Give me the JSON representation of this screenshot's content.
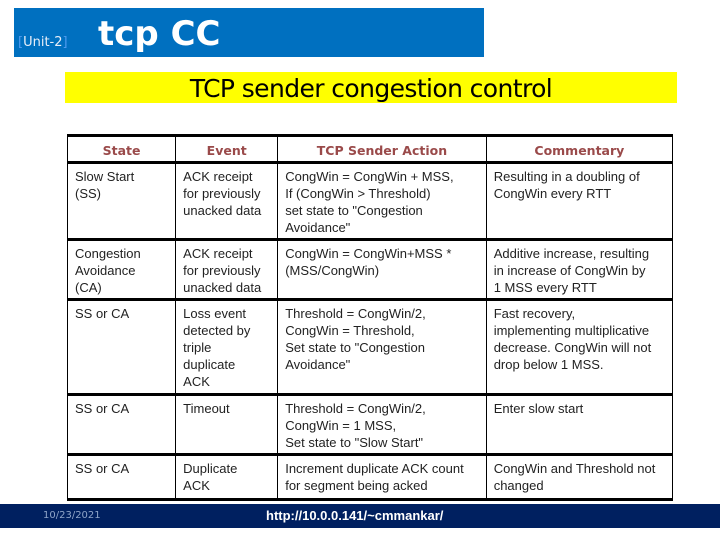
{
  "header": {
    "unit_label": "Unit-2",
    "unit_bracket_open": "[",
    "unit_bracket_close": "]",
    "title": "tcp CC",
    "subtitle": "TCP sender congestion control"
  },
  "colors": {
    "title_bar": "#0070c0",
    "subtitle_bar": "#ffff00",
    "table_header_text": "#9a4a4a",
    "footer_bar": "#002060"
  },
  "table": {
    "columns": [
      "State",
      "Event",
      "TCP Sender Action",
      "Commentary"
    ],
    "rows": [
      {
        "state": "Slow Start\n(SS)",
        "event": "ACK receipt\nfor previously\nunacked data",
        "action": "CongWin = CongWin + MSS,\nIf (CongWin > Threshold)\n      set state to \"Congestion\nAvoidance\"",
        "commentary": "Resulting in a doubling of\nCongWin every RTT"
      },
      {
        "state": "Congestion\nAvoidance\n(CA)",
        "event": "ACK receipt\nfor previously\nunacked data",
        "action": "CongWin = CongWin+MSS *\n(MSS/CongWin)",
        "commentary": "Additive increase, resulting\nin increase of CongWin  by\n1 MSS every RTT"
      },
      {
        "state": "SS or CA",
        "event": "Loss event\ndetected by\ntriple\nduplicate\nACK",
        "action": "Threshold = CongWin/2,\nCongWin = Threshold,\nSet state to \"Congestion\nAvoidance\"",
        "commentary": "Fast recovery,\nimplementing multiplicative\ndecrease. CongWin will not\ndrop below 1 MSS."
      },
      {
        "state": "SS or CA",
        "event": "Timeout",
        "action": "Threshold = CongWin/2,\nCongWin = 1 MSS,\nSet state to \"Slow Start\"",
        "commentary": "Enter slow start"
      },
      {
        "state": "SS or CA",
        "event": "Duplicate\nACK",
        "action": "Increment duplicate ACK count\nfor segment being acked",
        "commentary": "CongWin and Threshold not\nchanged"
      }
    ]
  },
  "footer": {
    "date": "10/23/2021",
    "url": "http://10.0.0.141/~cmmankar/"
  }
}
